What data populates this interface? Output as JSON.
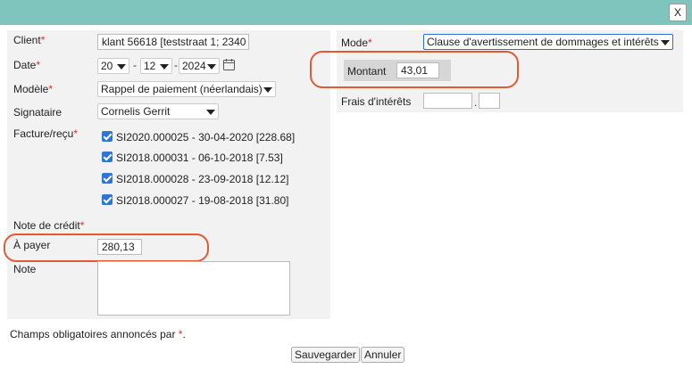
{
  "window": {
    "close_label": "X"
  },
  "form": {
    "client_label": "Client",
    "client_value": "klant 56618 [teststraat 1; 2340",
    "date_label": "Date",
    "date_day": "20",
    "date_month": "12",
    "date_year": "2024",
    "date_sep": "-",
    "model_label": "Modèle",
    "model_value": "Rappel de paiement (néerlandais)",
    "signatory_label": "Signataire",
    "signatory_value": "Cornelis Gerrit",
    "invoice_label": "Facture/reçu",
    "invoices": [
      "SI2020.000025 - 30-04-2020 [228.68]",
      "SI2018.000031 - 06-10-2018 [7.53]",
      "SI2018.000028 - 23-09-2018 [12.12]",
      "SI2018.000027 - 19-08-2018 [31.80]"
    ],
    "credit_note_label": "Note de crédit",
    "to_pay_label": "À payer",
    "to_pay_value": "280,13",
    "note_label": "Note",
    "required_mark": "*"
  },
  "right": {
    "mode_label": "Mode",
    "mode_value": "Clause d'avertissement de dommages et intérêts",
    "amount_label": "Montant",
    "amount_value": "43,01",
    "interest_label": "Frais d'intérêts",
    "interest_sep": "."
  },
  "footer": {
    "required_note": "Champs obligatoires annoncés par",
    "required_note_end": ".",
    "save_label": "Sauvegarder",
    "cancel_label": "Annuler"
  },
  "colors": {
    "titlebar": "#7fc4bd",
    "highlight": "#e15a33",
    "required": "#d9302c",
    "checkbox": "#2b77d4"
  }
}
